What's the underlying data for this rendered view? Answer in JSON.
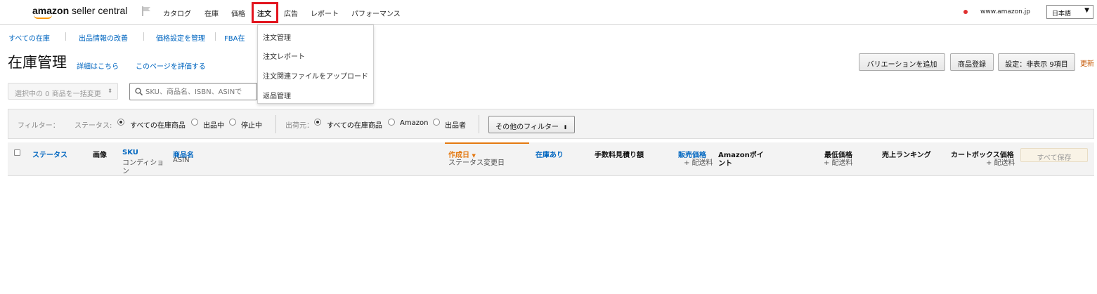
{
  "header": {
    "logo_amazon": "amazon",
    "logo_seller": " seller central",
    "nav": [
      "カタログ",
      "在庫",
      "価格",
      "注文",
      "広告",
      "レポート",
      "パフォーマンス"
    ],
    "site": "www.amazon.jp",
    "language": "日本語",
    "language_arrow": "▼"
  },
  "subnav": [
    "すべての在庫",
    "出品情報の改善",
    "価格設定を管理",
    "FBA在"
  ],
  "orders_menu": [
    "注文管理",
    "注文レポート",
    "注文関連ファイルをアップロード",
    "返品管理"
  ],
  "title": {
    "text": "在庫管理",
    "detail_link": "詳細はこちら",
    "rate_link": "このページを評価する"
  },
  "actions": {
    "add_variation": "バリエーションを追加",
    "add_product": "商品登録",
    "settings": "設定：非表示 9項目",
    "refresh": "更新"
  },
  "bulk": {
    "label": "選択中の 0 商品を一括変更",
    "chevron": "⬍"
  },
  "search": {
    "placeholder": "SKU、商品名、ISBN、ASINで"
  },
  "filters": {
    "label": "フィルター：",
    "status_label": "ステータス:",
    "status_options": [
      "すべての在庫商品",
      "出品中",
      "停止中"
    ],
    "status_selected": 0,
    "origin_label": "出荷元：",
    "origin_options": [
      "すべての在庫商品",
      "Amazon",
      "出品者"
    ],
    "origin_selected": 0,
    "more_filters": "その他のフィルター",
    "more_arrow": "⬍"
  },
  "table": {
    "status": "ステータス",
    "image": "画像",
    "sku": "SKU",
    "condition_l1": "コンディショ",
    "condition_l2": "ン",
    "product_name": "商品名",
    "asin": "ASIN",
    "created": "作成日",
    "created_arrow": "▼",
    "status_changed": "ステータス変更日",
    "in_stock": "在庫あり",
    "fee_estimate": "手数料見積り額",
    "price": "販売価格",
    "price_sub": "+ 配送料",
    "points_l1": "Amazonポイ",
    "points_l2": "ント",
    "lowest_price": "最低価格",
    "lowest_sub": "+ 配送料",
    "sales_rank": "売上ランキング",
    "buybox_price": "カートボックス価格",
    "buybox_sub": "+ 配送料",
    "save_all": "すべて保存"
  }
}
